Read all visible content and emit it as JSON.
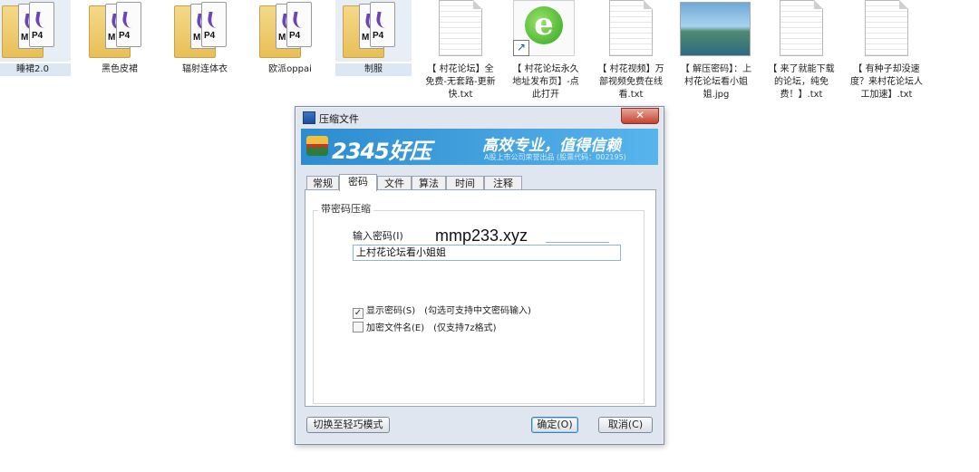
{
  "desktop": {
    "files": [
      {
        "name": "睡裙2.0",
        "type": "folder",
        "tags": [
          "MP4",
          "P4"
        ]
      },
      {
        "name": "黑色皮裙",
        "type": "folder",
        "tags": [
          "MP4",
          "P4"
        ]
      },
      {
        "name": "辐射连体衣",
        "type": "folder",
        "tags": [
          "MP4",
          "P4"
        ]
      },
      {
        "name": "欧派oppai",
        "type": "folder",
        "tags": [
          "MP4",
          "P4"
        ]
      },
      {
        "name": "制服",
        "type": "folder",
        "tags": [
          "MP4",
          "P4"
        ]
      },
      {
        "name": "【 村花论坛】全免费-无套路-更新快.txt",
        "type": "txt"
      },
      {
        "name": "【 村花论坛永久地址发布页】-点此打开",
        "type": "shortcut"
      },
      {
        "name": "【 村花视频】万部视频免费在线看.txt",
        "type": "txt"
      },
      {
        "name": "【 解压密码】：上村花论坛看小姐姐.jpg",
        "type": "jpg"
      },
      {
        "name": "【 来了就能下载的论坛，纯免费！】.txt",
        "type": "txt"
      },
      {
        "name": "【 有种子却没速度？来村花论坛人工加速】.txt",
        "type": "txt"
      }
    ]
  },
  "dialog": {
    "title": "压缩文件",
    "close_glyph": "✕",
    "banner": {
      "brand": "2345好压",
      "slogan": "高效专业，值得信赖",
      "sub": "A股上市公司荣誉出品 (股票代码：002195)"
    },
    "tabs": [
      "常规",
      "密码",
      "文件",
      "算法",
      "时间",
      "注释"
    ],
    "active_tab": "密码",
    "group_title": "带密码压缩",
    "password_label": "输入密码(I)",
    "password_value": "上村花论坛看小姐姐",
    "show_password": {
      "label": "显示密码(S)",
      "checked": true,
      "note": "(勾选可支持中文密码输入)"
    },
    "encrypt_filenames": {
      "label": "加密文件名(E)",
      "checked": false,
      "note": "(仅支持7z格式)"
    },
    "buttons": {
      "switch_mode": "切换至轻巧模式",
      "ok": "确定(O)",
      "cancel": "取消(C)"
    }
  },
  "watermark": "mmp233.xyz",
  "colors": {
    "banner": "#2d8ccf",
    "dialog_bg": "#dfe6ef",
    "close_button": "#c4432e",
    "folder": "#e9bf57"
  }
}
